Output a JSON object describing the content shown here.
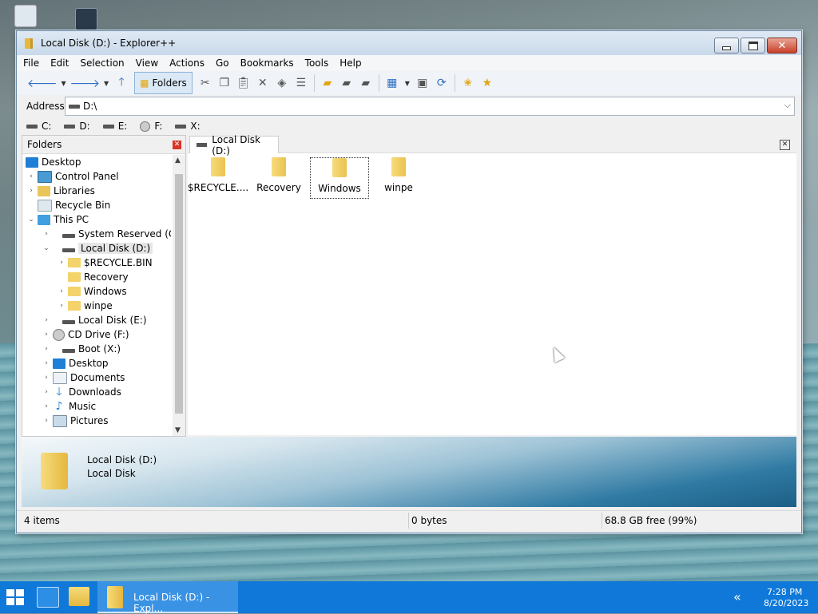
{
  "window": {
    "title": "Local Disk (D:) - Explorer++"
  },
  "menu": [
    "File",
    "Edit",
    "Selection",
    "View",
    "Actions",
    "Go",
    "Bookmarks",
    "Tools",
    "Help"
  ],
  "toolbar": {
    "folders_label": "Folders"
  },
  "address": {
    "label": "Address",
    "value": "D:\\"
  },
  "drives": [
    "C:",
    "D:",
    "E:",
    "F:",
    "X:"
  ],
  "folders_pane": {
    "title": "Folders",
    "tree": [
      {
        "label": "Desktop",
        "icon": "desktop"
      },
      {
        "label": "Control Panel",
        "icon": "cpl"
      },
      {
        "label": "Libraries",
        "icon": "lib"
      },
      {
        "label": "Recycle Bin",
        "icon": "bin"
      },
      {
        "label": "This PC",
        "icon": "pc"
      },
      {
        "label": "System Reserved (C:)",
        "icon": "drive"
      },
      {
        "label": "Local Disk (D:)",
        "icon": "drive"
      },
      {
        "label": "$RECYCLE.BIN",
        "icon": "folder"
      },
      {
        "label": "Recovery",
        "icon": "folder"
      },
      {
        "label": "Windows",
        "icon": "folder"
      },
      {
        "label": "winpe",
        "icon": "folder"
      },
      {
        "label": "Local Disk (E:)",
        "icon": "drive"
      },
      {
        "label": "CD Drive (F:)",
        "icon": "cd"
      },
      {
        "label": "Boot (X:)",
        "icon": "drive"
      },
      {
        "label": "Desktop",
        "icon": "desktop"
      },
      {
        "label": "Documents",
        "icon": "docs"
      },
      {
        "label": "Downloads",
        "icon": "dl"
      },
      {
        "label": "Music",
        "icon": "music"
      },
      {
        "label": "Pictures",
        "icon": "pics"
      }
    ]
  },
  "tab": {
    "label": "Local Disk (D:)"
  },
  "files": [
    "$RECYCLE....",
    "Recovery",
    "Windows",
    "winpe"
  ],
  "details": {
    "name": "Local Disk (D:)",
    "type": "Local Disk"
  },
  "status": {
    "items": "4 items",
    "size": "0 bytes",
    "free": "68.8 GB free (99%)"
  },
  "taskbar": {
    "app_label": "Local Disk (D:) - Expl...",
    "time": "7:28 PM",
    "date": "8/20/2023"
  },
  "colors": {
    "taskbar": "#0f78d8",
    "accent": "#1f7ed6",
    "folder": "#f3d36a"
  }
}
